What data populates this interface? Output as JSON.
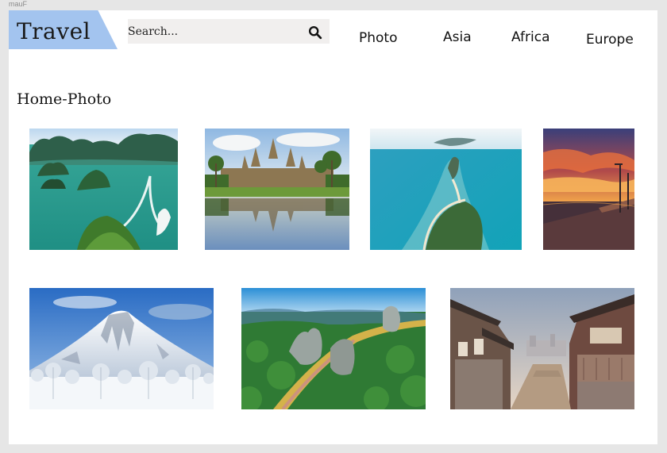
{
  "frame": {
    "label": "mauF"
  },
  "header": {
    "logo_text": "Travel",
    "search_placeholder": "Search...",
    "nav": [
      "Photo",
      "Asia",
      "Africa",
      "Europe"
    ]
  },
  "breadcrumb": "Home-Photo",
  "gallery": {
    "photos": [
      {
        "subject": "ha-long-bay"
      },
      {
        "subject": "angkor-wat"
      },
      {
        "subject": "island-sandbar"
      },
      {
        "subject": "sunset-pier"
      },
      {
        "subject": "snow-mountain"
      },
      {
        "subject": "golden-bridge-hands"
      },
      {
        "subject": "hanok-alley"
      }
    ]
  },
  "colors": {
    "logo_bg": "#a3c4ef",
    "search_bg": "#f1efee",
    "page_bg": "#ffffff",
    "canvas_bg": "#e6e6e6"
  }
}
